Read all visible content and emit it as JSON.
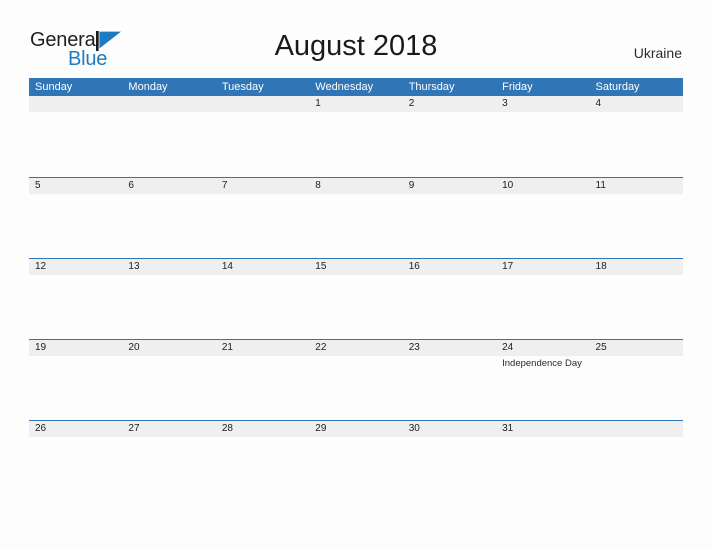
{
  "brand": {
    "word_general": "General",
    "word_blue": "Blue",
    "flag_icon": "blue-triangle-flag-icon",
    "accent_color": "#1f7bc1"
  },
  "header": {
    "month_title": "August 2018",
    "country": "Ukraine"
  },
  "colors": {
    "header_blue": "#3075b5",
    "row_divider_blue": "#2e75b6",
    "number_band_gray": "#efefef",
    "page_background": "#fdfdfd",
    "text_dark": "#202020"
  },
  "calendar": {
    "day_headers": [
      "Sunday",
      "Monday",
      "Tuesday",
      "Wednesday",
      "Thursday",
      "Friday",
      "Saturday"
    ],
    "weeks": [
      {
        "days": [
          {
            "number": "",
            "event": ""
          },
          {
            "number": "",
            "event": ""
          },
          {
            "number": "",
            "event": ""
          },
          {
            "number": "1",
            "event": ""
          },
          {
            "number": "2",
            "event": ""
          },
          {
            "number": "3",
            "event": ""
          },
          {
            "number": "4",
            "event": ""
          }
        ]
      },
      {
        "days": [
          {
            "number": "5",
            "event": ""
          },
          {
            "number": "6",
            "event": ""
          },
          {
            "number": "7",
            "event": ""
          },
          {
            "number": "8",
            "event": ""
          },
          {
            "number": "9",
            "event": ""
          },
          {
            "number": "10",
            "event": ""
          },
          {
            "number": "11",
            "event": ""
          }
        ]
      },
      {
        "days": [
          {
            "number": "12",
            "event": ""
          },
          {
            "number": "13",
            "event": ""
          },
          {
            "number": "14",
            "event": ""
          },
          {
            "number": "15",
            "event": ""
          },
          {
            "number": "16",
            "event": ""
          },
          {
            "number": "17",
            "event": ""
          },
          {
            "number": "18",
            "event": ""
          }
        ]
      },
      {
        "days": [
          {
            "number": "19",
            "event": ""
          },
          {
            "number": "20",
            "event": ""
          },
          {
            "number": "21",
            "event": ""
          },
          {
            "number": "22",
            "event": ""
          },
          {
            "number": "23",
            "event": ""
          },
          {
            "number": "24",
            "event": "Independence Day"
          },
          {
            "number": "25",
            "event": ""
          }
        ]
      },
      {
        "days": [
          {
            "number": "26",
            "event": ""
          },
          {
            "number": "27",
            "event": ""
          },
          {
            "number": "28",
            "event": ""
          },
          {
            "number": "29",
            "event": ""
          },
          {
            "number": "30",
            "event": ""
          },
          {
            "number": "31",
            "event": ""
          },
          {
            "number": "",
            "event": ""
          }
        ]
      }
    ]
  }
}
